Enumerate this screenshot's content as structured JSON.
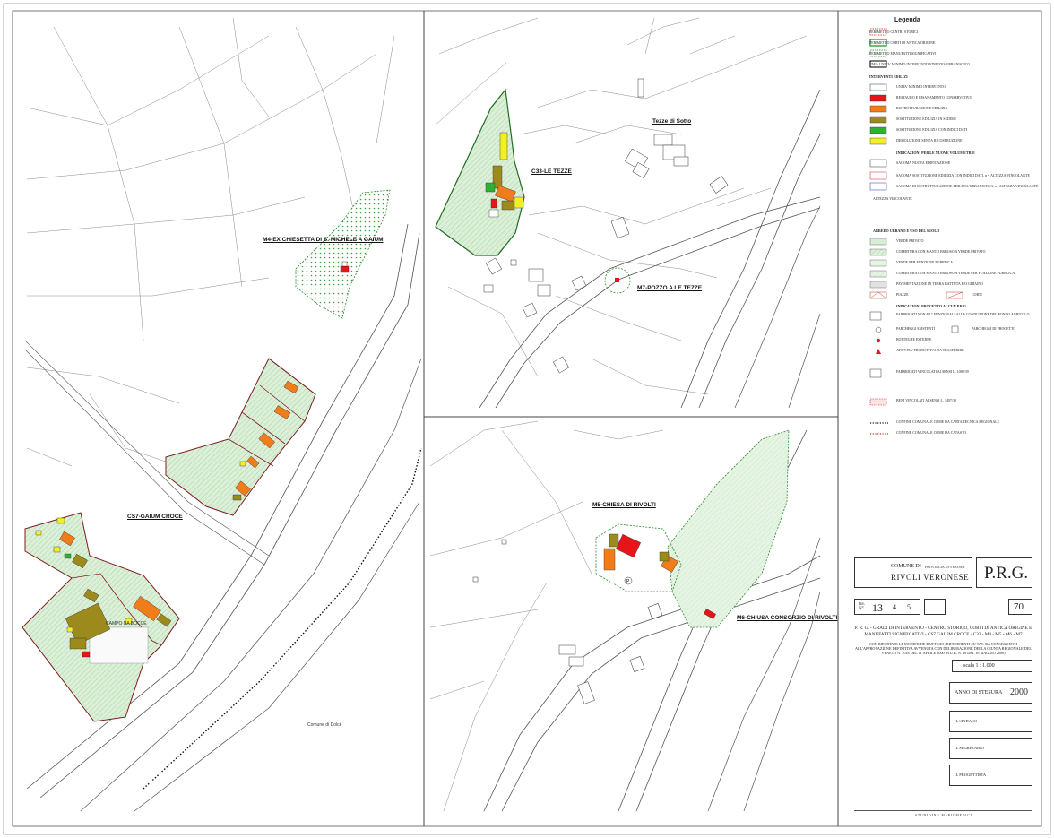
{
  "map": {
    "labels": {
      "m4": "M4-EX CHIESETTA DI S. MICHELE A GAIUM",
      "cs7": "CS7-GAIUM CROCE",
      "c33": "C33-LE TEZZE",
      "tezze_sotto": "Tezze di Sotto",
      "m7": "M7-POZZO A LE TEZZE",
      "m5": "M5-CHIESA DI RIVOLTI",
      "m6": "M6-CHIUSA CONSORZIO DI RIVOLTI",
      "campo": "CAMPO DA BOCCE",
      "comune_dolce": "Comune di Dolcè"
    }
  },
  "legend": {
    "title": "Legenda",
    "perimeters": [
      "PERIMETRO CENTRI STORICI",
      "PERIMETRO CORTI DI ANTICA ORIGINE",
      "PERIMETRO MANUFATTI SIGNIFICATIVI",
      "UMI - UNITA' MINIMO INTERVENTO EDILIZIO-URBANISTICO"
    ],
    "interventi_title": "INTERVENTI EDILIZI",
    "interventi": [
      "UNITA' MINIMO INTERVENTO",
      "RESTAURO E RISANAMENTO CONSERVATIVO",
      "RISTRUTTURAZIONE EDILIZIA",
      "SOSTITUZIONE EDILIZIA IN SEDIME",
      "SOSTITUZIONE EDILIZIA CON INDICI DATI",
      "DEMOLIZIONE SENZA RICOSTRUZIONE"
    ],
    "volumetrie_title": "INDICAZIONI PER LE NUOVE VOLUMETRIE",
    "volumetrie": [
      "SAGOMA NUOVA EDIFICAZIONE",
      "SAGOMA SOSTITUZIONE EDILIZIA CON INDICI DATI, n = ALTEZZA VINCOLANTE",
      "SAGOMA DI RISTRUTTURAZIONE EDILIZIA/URBANISTICA, n=ALTEZZA VINCOLANTE"
    ],
    "altezze_label": "ALTEZZA VINCOLANTE",
    "arredo_title": "ARREDO URBANO E USO DEL SUOLO",
    "arredo": [
      "VERDE PRIVATO",
      "COPERTURA CON MANTO ERBOSO A VERDE PRIVATO",
      "VERDE PER FUNZIONE PUBBLICA",
      "COPERTURA CON MANTO ERBOSO A VERDE PER FUNZIONE PUBBLICA",
      "PAVIMENTAZIONE IN TERRA BATTUTA E/O GHIAINO"
    ],
    "piazze": "PIAZZE",
    "corti": "CORTI",
    "prg_title": "INDICAZIONI PROGETTO ALCUN P.R.G.",
    "prg_items": [
      "FABBRICATI NON PIU' FUNZIONALI ALLA CONDUZIONE DEL FONDO AGRICOLO",
      "PARCHEGGI ESISTENTI",
      "BOTTEGHE ESTERNE",
      "ATTIVITA' PRODUTTIVA DA TRASFERIRE",
      "FABBRICATI VINCOLATI AI SENSI L. 1089/39",
      "BENI VINCOLATI AI SENSI L. 1497/39",
      "CONFINE COMUNALE COME DA CARTA TECNICA REGIONALE",
      "CONFINE COMUNALE COME DA CATASTO"
    ],
    "parcheggi_progetto": "PARCHEGGI DI PROGETTO"
  },
  "title_block": {
    "comune_di": "COMUNE DI",
    "provincia": "PROVINCIA DI VERONA",
    "comune": "RIVOLI VERONESE",
    "plan": "P.R.G.",
    "tav_label": "tav. N°",
    "tav_number": "13",
    "sub_a": "4",
    "sub_b": "5",
    "sheet_number": "70",
    "description": "P. R. G. - GRADI DI INTERVENTO - CENTRO STORICO, CORTI DI ANTICA ORIGINE E MANUFATTI SIGNIFICATIVI - CS7 GAIUM CROCE - C33 - M4 - M5 - M6 - M7",
    "note": "CON RIPORTATE LE MODIFICHE D'UFFICIO (RIFERIMENTI SU TAV. 8b) CONSEGUENTI ALL'APPROVAZIONE DEFINITIVA AVVENUTA CON DELIBERAZIONE DELLA GIUNTA REGIONALE DEL VENETO N. 1018 DEL 11 APRILE 2000 (B.U.R. N. 46 DEL 16 MAGGIO 2000)",
    "scala": "scala  1 : 1.000",
    "anno_label": "ANNO DI STESURA",
    "anno": "2000",
    "sindaco": "IL SINDACO",
    "segretario": "IL SEGRETARIO",
    "progettista": "IL PROGETTISTA",
    "studio": "S T U D I O   I N G .   M A R I O   M E D I C I"
  },
  "colors": {
    "restauro": "#e8141b",
    "ristrutturazione": "#f07d1a",
    "sostituzione_sedime": "#9c8a1c",
    "sostituzione_indici": "#2fb12f",
    "demolizione": "#f2ee2a",
    "verde": "#d8edd6"
  }
}
